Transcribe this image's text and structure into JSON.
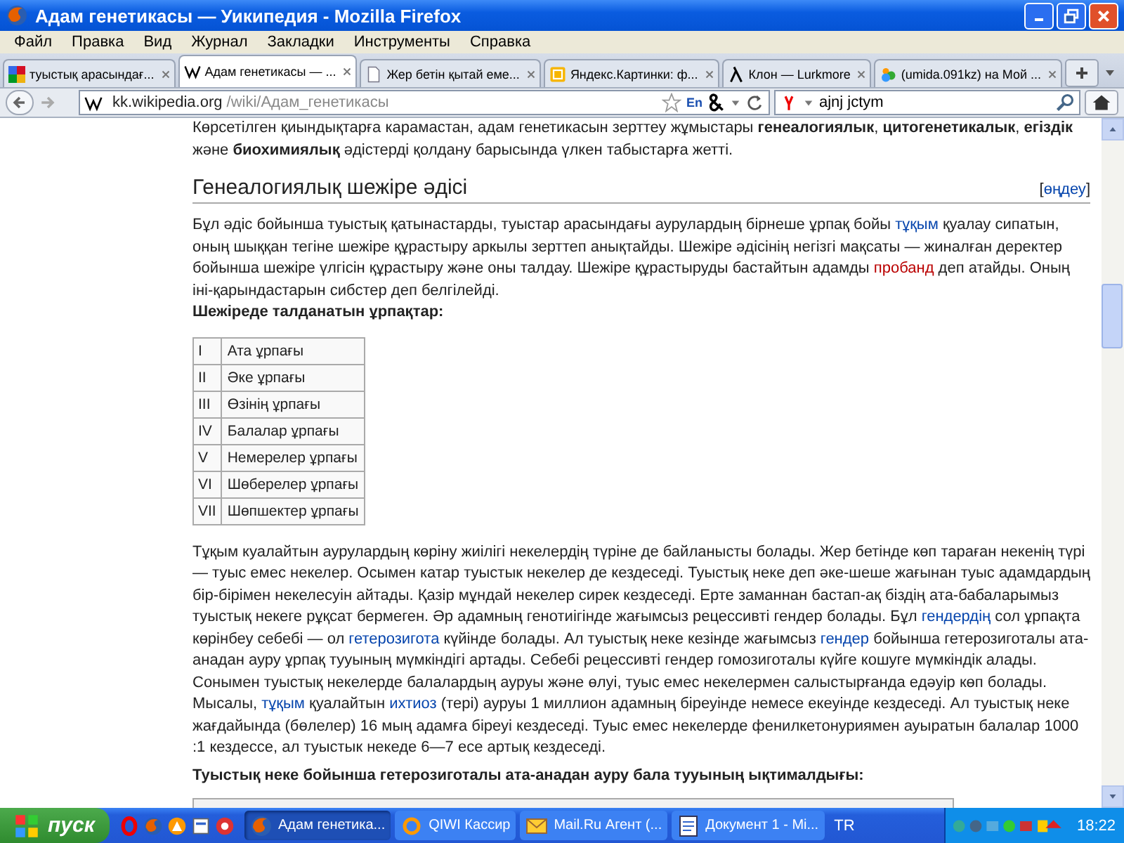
{
  "window": {
    "title": "Адам генетикасы — Уикипедия - Mozilla Firefox"
  },
  "menu": [
    "Файл",
    "Правка",
    "Вид",
    "Журнал",
    "Закладки",
    "Инструменты",
    "Справка"
  ],
  "tabs": [
    {
      "label": "туыстық арасындағ...",
      "selected": false,
      "kind": "google"
    },
    {
      "label": "Адам генетикасы — ...",
      "selected": true,
      "kind": "wiki"
    },
    {
      "label": "Жер бетін қытай еме...",
      "selected": false,
      "kind": "page"
    },
    {
      "label": "Яндекс.Картинки: ф...",
      "selected": false,
      "kind": "yandex"
    },
    {
      "label": "Клон — Lurkmore",
      "selected": false,
      "kind": "lambda"
    },
    {
      "label": "(umida.091kz) на Мой ...",
      "selected": false,
      "kind": "people"
    }
  ],
  "address": {
    "host": "kk.wikipedia.org",
    "path": "/wiki/Адам_генетикасы"
  },
  "addon_label": "En",
  "search": {
    "value": "ajnj jctym"
  },
  "article": {
    "intro": "Көрсетілген қиындықтарға карамастан, адам генетикасын зерттеу жұмыстары **генеалогиялык**, **цитогенетикалык**, **егіздік** және **биохимиялық** әдістерді қолдану барысында үлкен табыстарға жетті.",
    "heading": "Генеалогиялық шежіре әдісі",
    "edit": {
      "open": "[",
      "link": "өңдеу",
      "close": "]"
    },
    "paragraph1": [
      {
        "kind": "text",
        "text": "Бұл әдіс бойынша туыстық қатынастарды, туыстар арасындағы аурулардың бірнеше ұрпақ бойы "
      },
      {
        "kind": "link",
        "text": "тұқым"
      },
      {
        "kind": "text",
        "text": " қуалау сипатын, оның шыққан тегіне шежіре құрастыру аркылы зерттеп анықтайды. Шежіре әдісінің негізгі мақсаты — жиналған деректер бойынша шежіре үлгісін құрастыру және оны талдау. Шежіре құрастыруды бастайтын адамды "
      },
      {
        "kind": "redlink",
        "text": "пробанд"
      },
      {
        "kind": "text",
        "text": " деп атайды. Оның іні-қарындастарын сибстер деп белгілейді."
      }
    ],
    "subheading": "Шежіреде талданатын ұрпақтар:",
    "generations": [
      {
        "numeral": "I",
        "name": "Ата ұрпағы"
      },
      {
        "numeral": "II",
        "name": "Әке ұрпағы"
      },
      {
        "numeral": "III",
        "name": "Өзінің ұрпағы"
      },
      {
        "numeral": "IV",
        "name": "Балалар ұрпағы"
      },
      {
        "numeral": "V",
        "name": "Немерелер ұрпағы"
      },
      {
        "numeral": "VI",
        "name": "Шөберелер ұрпағы"
      },
      {
        "numeral": "VII",
        "name": "Шөпшектер ұрпағы"
      }
    ],
    "paragraph2": [
      {
        "kind": "text",
        "text": "Тұқым куалайтын аурулардың көріну жиілігі некелердің түріне де байланысты болады. Жер бетінде көп тараған некенің түрі — туыс емес некелер. Осымен катар туыстык некелер де кездеседі. Туыстық неке деп әке-шеше жағынан туыс адамдардың бір-бірімен некелесуін айтады. Қазір мұндай некелер сирек кездеседі. Ерте заманнан бастап-ақ біздің ата-бабаларымыз туыстық некеге рұқсат бермеген. Әр адамның генотиігінде жағымсыз рецессивті гендер болады. Бұл "
      },
      {
        "kind": "link",
        "text": "гендердің"
      },
      {
        "kind": "text",
        "text": " сол ұрпақта көрінбеу себебі — ол "
      },
      {
        "kind": "link",
        "text": "гетерозигота"
      },
      {
        "kind": "text",
        "text": " күйінде болады. Ал туыстық неке кезінде жағымсыз "
      },
      {
        "kind": "link",
        "text": "гендер"
      },
      {
        "kind": "text",
        "text": " бойынша гетерозиготалы ата-анадан ауру ұрпақ тууының мүмкіндігі артады. Себебі рецессивті гендер гомозиготалы күйге кошуге мүмкіндік алады. Сонымен туыстық некелерде балалардың ауруы және өлуі, туыс емес некелермен салыстырғанда едәуір көп болады. Мысалы, "
      },
      {
        "kind": "link",
        "text": "тұқым"
      },
      {
        "kind": "text",
        "text": " қуалайтын "
      },
      {
        "kind": "link",
        "text": "ихтиоз"
      },
      {
        "kind": "text",
        "text": " (тері) ауруы 1 миллион адамның біреуінде немесе екеуінде кездеседі. Ал туыстық неке жағдайында (бөлелер) 16 мың адамға біреуі кездеседі. Туыс емес некелерде фенилкетонуриямен ауыратын балалар 1000 :1 кездессе, ал туыстык некеде 6—7 есе артық кездеседі."
      }
    ],
    "subheading2": "Туыстық неке бойынша гетерозиготалы ата-анадан ауру бала тууының ықтималдығы:"
  },
  "taskbar": {
    "start": "пуск",
    "tasks": [
      {
        "label": "Адам генетика...",
        "selected": true,
        "kind": "firefox"
      },
      {
        "label": "QIWI Кассир",
        "selected": false,
        "kind": "qiwi"
      },
      {
        "label": "Mail.Ru Агент (...",
        "selected": false,
        "kind": "mail"
      },
      {
        "label": "Документ 1 - Mi...",
        "selected": false,
        "kind": "word"
      }
    ],
    "language": "TR",
    "clock": "18:22"
  }
}
